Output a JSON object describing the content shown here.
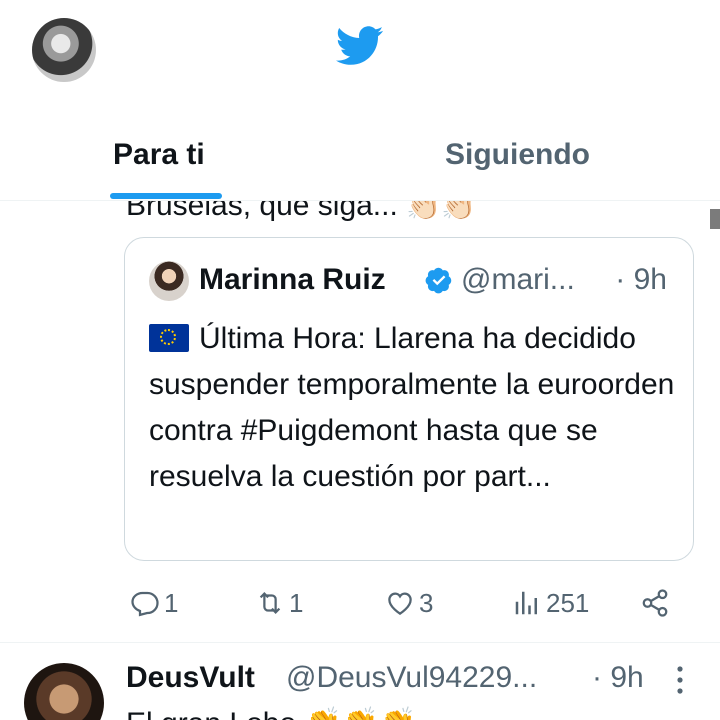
{
  "header": {
    "avatar": "user-avatar",
    "logo": "twitter-bird-icon",
    "brand_color": "#1d9bf0"
  },
  "tabs": [
    {
      "label": "Para ti",
      "active": true
    },
    {
      "label": "Siguiendo",
      "active": false
    }
  ],
  "tweet1": {
    "cut_text": "Bruselas, que siga...",
    "cut_emoji": "👏🏻👏🏻",
    "quote": {
      "name": "Marinna Ruiz",
      "verified": true,
      "handle": "@mari...",
      "time": "· 9h",
      "flag": "eu-flag-icon",
      "text": "Última Hora: Llarena ha decidido suspender temporalmente la euroorden contra #Puigdemont hasta que se resuelva la cuestión por part..."
    },
    "actions": {
      "replies": "1",
      "retweets": "1",
      "likes": "3",
      "views": "251"
    }
  },
  "tweet2": {
    "name": "DeusVult",
    "handle": "@DeusVul94229...",
    "time": "· 9h",
    "text": "El gran Lobo 👏👏👏"
  }
}
